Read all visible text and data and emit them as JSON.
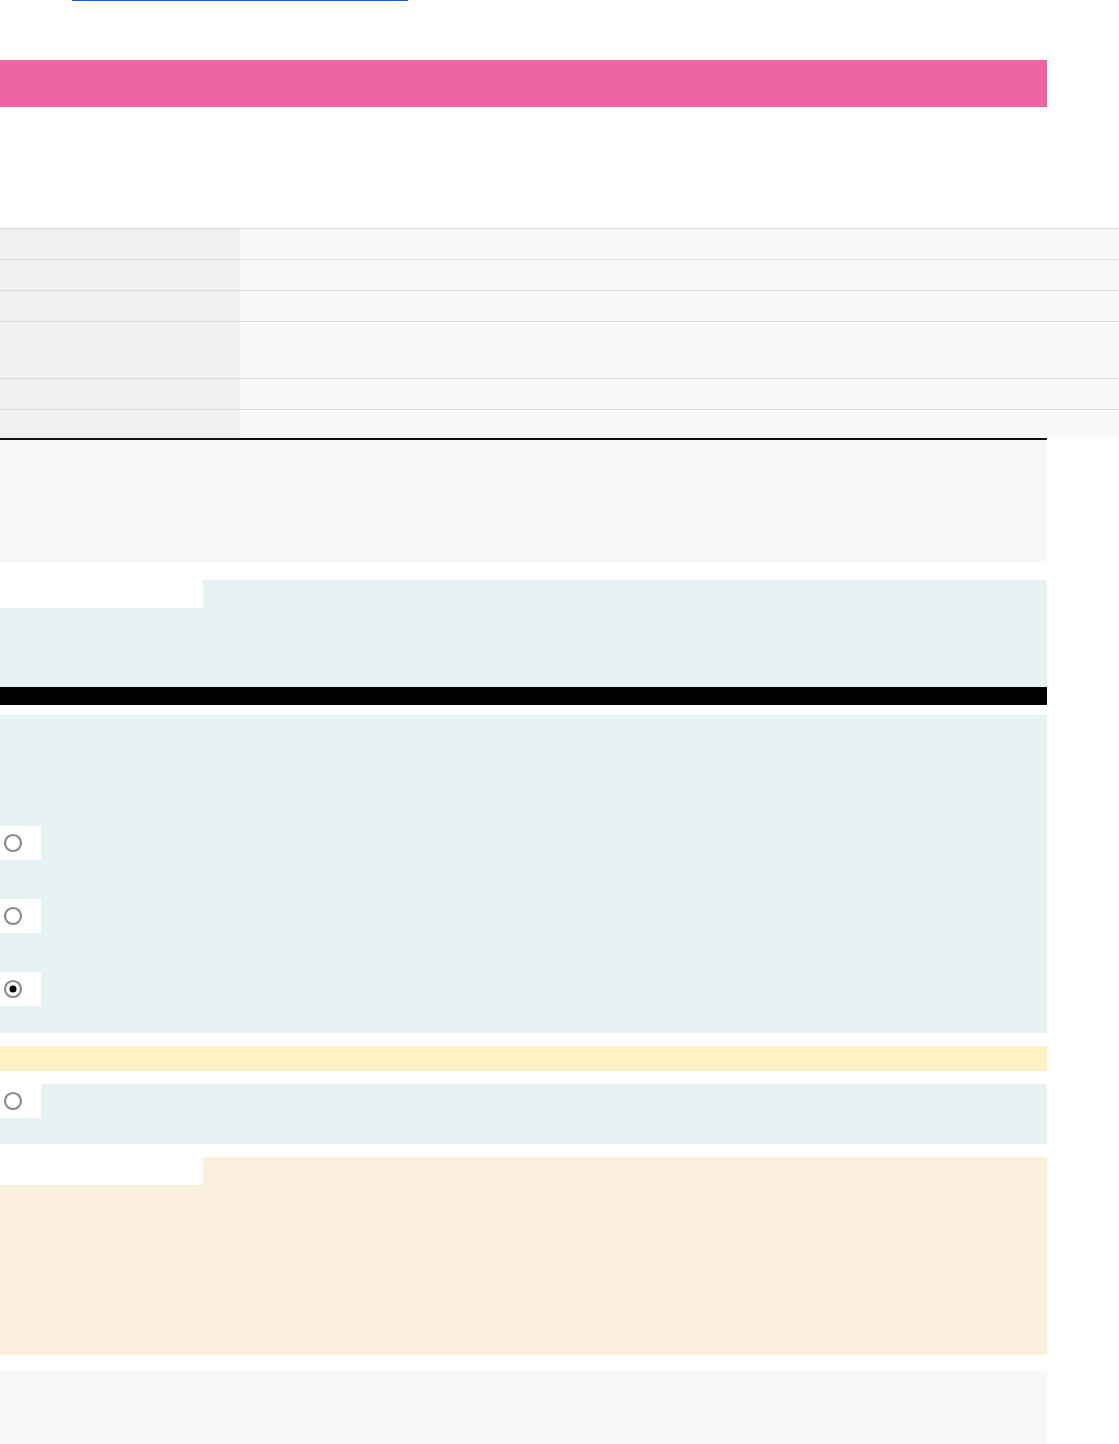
{
  "question": {
    "options": [
      {
        "selected": false
      },
      {
        "selected": false
      },
      {
        "selected": true
      }
    ]
  },
  "extra_option": {
    "selected": false
  }
}
